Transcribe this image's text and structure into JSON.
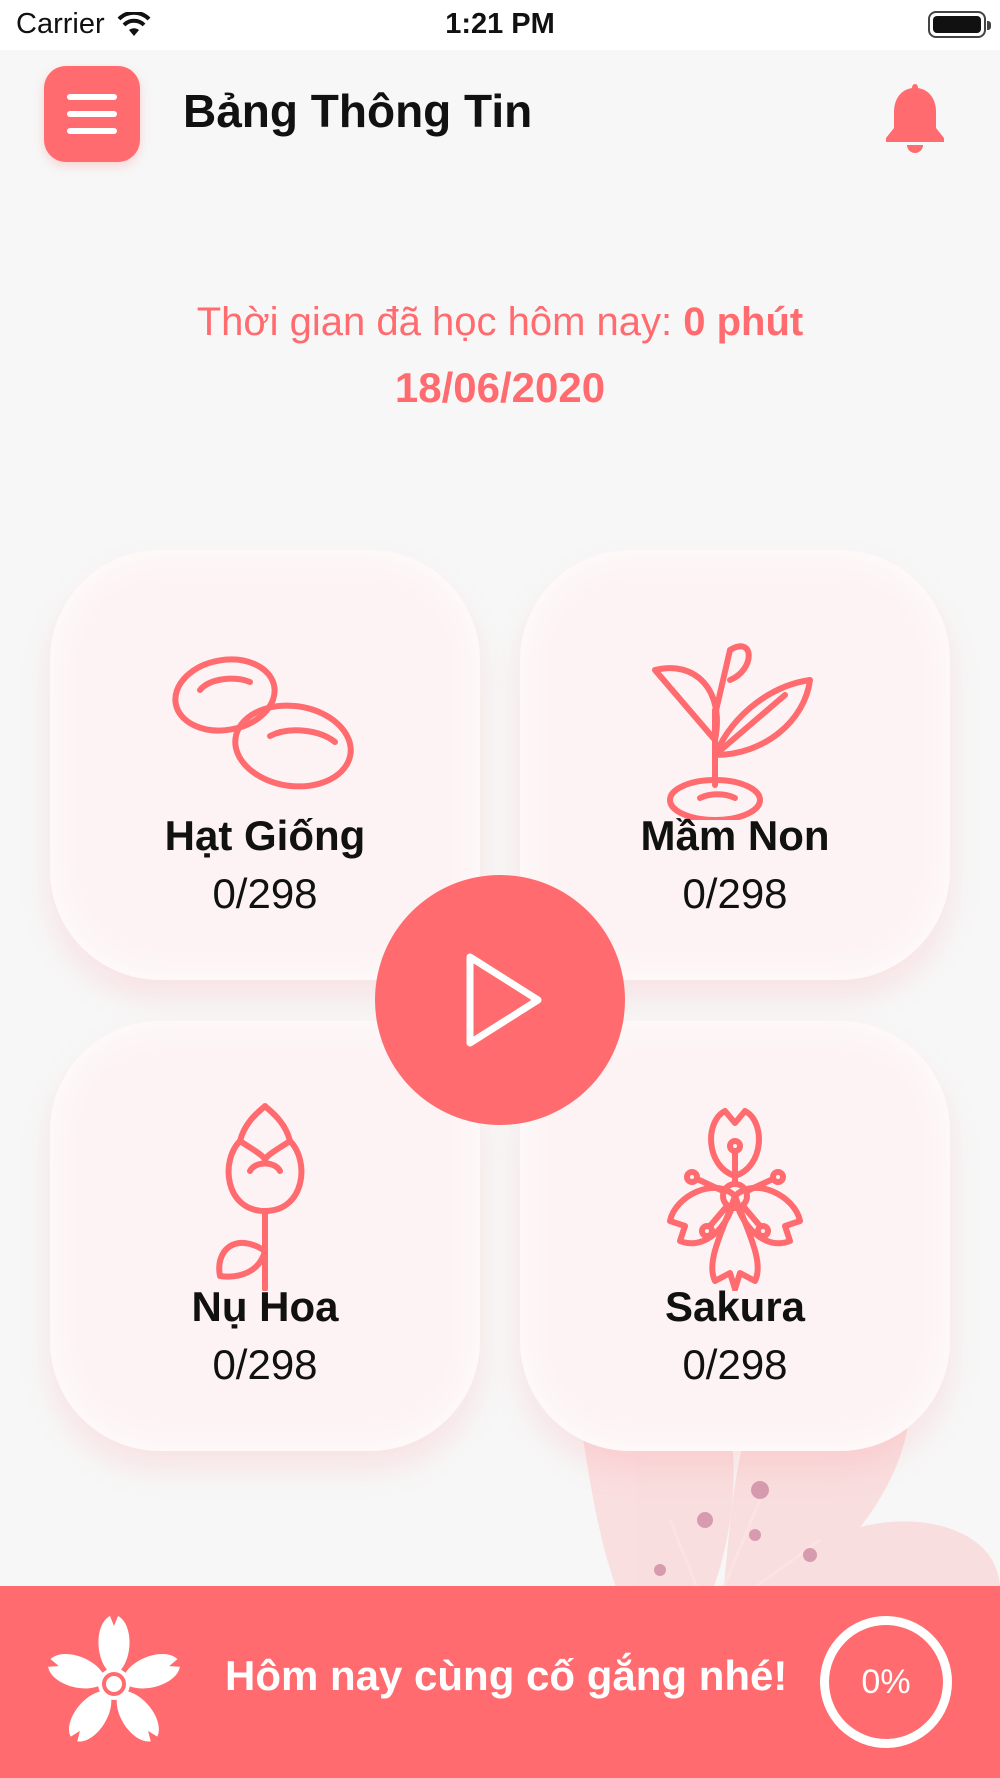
{
  "status_bar": {
    "carrier": "Carrier",
    "time": "1:21 PM"
  },
  "header": {
    "title": "Bảng Thông Tin",
    "menu_icon": "hamburger-menu-icon",
    "bell_icon": "bell-icon"
  },
  "study": {
    "label": "Thời gian đã học hôm nay:",
    "minutes": "0 phút",
    "date": "18/06/2020"
  },
  "cards": [
    {
      "label": "Hạt Giống",
      "count": "0/298",
      "icon": "seeds-icon"
    },
    {
      "label": "Mầm Non",
      "count": "0/298",
      "icon": "sprout-icon"
    },
    {
      "label": "Nụ Hoa",
      "count": "0/298",
      "icon": "flower-bud-icon"
    },
    {
      "label": "Sakura",
      "count": "0/298",
      "icon": "sakura-icon"
    }
  ],
  "play_button": {
    "icon": "play-icon"
  },
  "bottom_bar": {
    "message": "Hôm nay cùng cố gắng nhé!",
    "progress_label": "0%",
    "progress": 0
  },
  "colors": {
    "accent": "#ff6b6e",
    "card_bg": "#fdf3f4",
    "background": "#f7f7f7"
  }
}
